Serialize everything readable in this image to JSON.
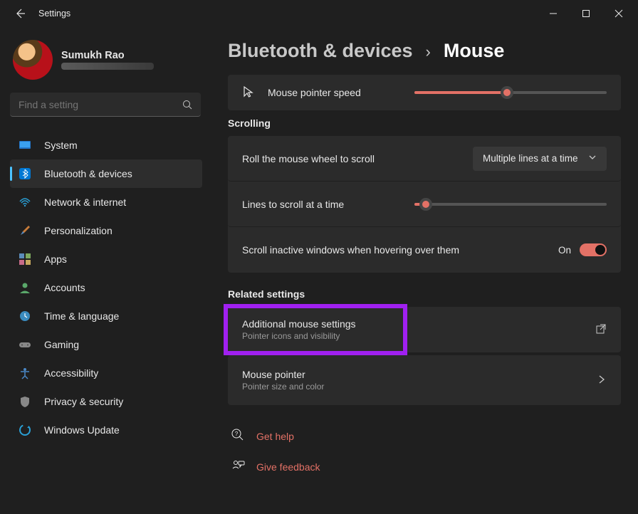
{
  "window": {
    "title": "Settings"
  },
  "profile": {
    "name": "Sumukh Rao"
  },
  "search": {
    "placeholder": "Find a setting"
  },
  "sidebar": {
    "items": [
      {
        "label": "System"
      },
      {
        "label": "Bluetooth & devices"
      },
      {
        "label": "Network & internet"
      },
      {
        "label": "Personalization"
      },
      {
        "label": "Apps"
      },
      {
        "label": "Accounts"
      },
      {
        "label": "Time & language"
      },
      {
        "label": "Gaming"
      },
      {
        "label": "Accessibility"
      },
      {
        "label": "Privacy & security"
      },
      {
        "label": "Windows Update"
      }
    ]
  },
  "breadcrumb": {
    "parent": "Bluetooth & devices",
    "current": "Mouse"
  },
  "content": {
    "pointer_speed_label": "Mouse pointer speed",
    "pointer_speed_value": 48,
    "scrolling_header": "Scrolling",
    "roll_label": "Roll the mouse wheel to scroll",
    "roll_value": "Multiple lines at a time",
    "lines_label": "Lines to scroll at a time",
    "lines_value": 6,
    "inactive_label": "Scroll inactive windows when hovering over them",
    "inactive_state": "On",
    "related_header": "Related settings",
    "adv": {
      "title": "Additional mouse settings",
      "sub": "Pointer icons and visibility"
    },
    "ptr": {
      "title": "Mouse pointer",
      "sub": "Pointer size and color"
    },
    "help": "Get help",
    "feedback": "Give feedback"
  }
}
